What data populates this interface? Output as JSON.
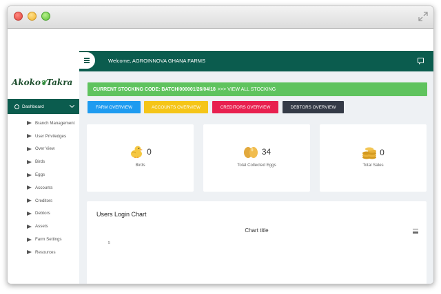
{
  "window": {
    "resize_icon": "expand-icon"
  },
  "sidebar": {
    "logo_text_1": "Akoko",
    "logo_text_2": "Takra",
    "dashboard_label": "Dashboard",
    "items": [
      {
        "label": "Branch Management"
      },
      {
        "label": "User Priviledges"
      },
      {
        "label": "Over View"
      },
      {
        "label": "Birds"
      },
      {
        "label": "Eggs"
      },
      {
        "label": "Accounts"
      },
      {
        "label": "Creditors"
      },
      {
        "label": "Debtors"
      },
      {
        "label": "Assets"
      },
      {
        "label": "Farm Settings"
      },
      {
        "label": "Resources"
      }
    ]
  },
  "topbar": {
    "welcome": "Welcome, AGROINNOVA GHANA FARMS"
  },
  "banner": {
    "code_text": "CURRENT STOCKING CODE: BATCH/000001/26/04/18",
    "link_text": ">>> VIEW ALL STOCKING"
  },
  "buttons": {
    "farm": "FARM OVERVIEW",
    "accounts": "ACCOUNTS OVERVIEW",
    "creditors": "CREDITORS OVERVIEW",
    "debtors": "DEBTORS OVERVIEW"
  },
  "stats": [
    {
      "icon": "chick-icon",
      "value": "0",
      "label": "Birds"
    },
    {
      "icon": "eggs-icon",
      "value": "34",
      "label": "Total Collected Eggs"
    },
    {
      "icon": "coins-icon",
      "value": "0",
      "label": "Total Sales"
    }
  ],
  "chart": {
    "heading": "Users Login Chart",
    "title": "Chart title",
    "y_tick": "5"
  },
  "colors": {
    "primary": "#0b5c4e",
    "banner": "#5fc35e",
    "farm_btn": "#1e9bf0",
    "accounts_btn": "#f5c518",
    "creditors_btn": "#e8204f",
    "debtors_btn": "#343a46"
  }
}
